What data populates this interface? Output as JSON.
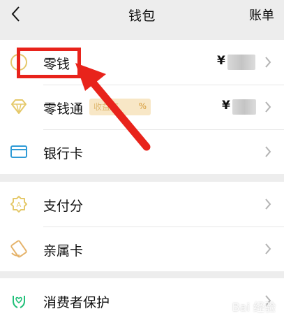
{
  "header": {
    "title": "钱包",
    "right_action": "账单"
  },
  "groups": [
    {
      "items": [
        {
          "label": "零钱",
          "amount_prefix": "¥",
          "icon": "coin-icon"
        },
        {
          "label": "零钱通",
          "amount_prefix": "¥",
          "icon": "diamond-icon",
          "badge": {
            "text": "收益率",
            "suffix": "%"
          }
        },
        {
          "label": "银行卡",
          "icon": "bank-card-icon"
        }
      ]
    },
    {
      "items": [
        {
          "label": "支付分",
          "icon": "payment-score-icon"
        },
        {
          "label": "亲属卡",
          "icon": "family-card-icon"
        }
      ]
    },
    {
      "items": [
        {
          "label": "消费者保护",
          "icon": "consumer-protection-icon"
        }
      ]
    }
  ],
  "watermark": "Bai 经验",
  "colors": {
    "accent": "#e5c96b",
    "green_icon": "#22c07a",
    "annotation_red": "#e8231b",
    "badge_bg": "#f8e7c6"
  }
}
